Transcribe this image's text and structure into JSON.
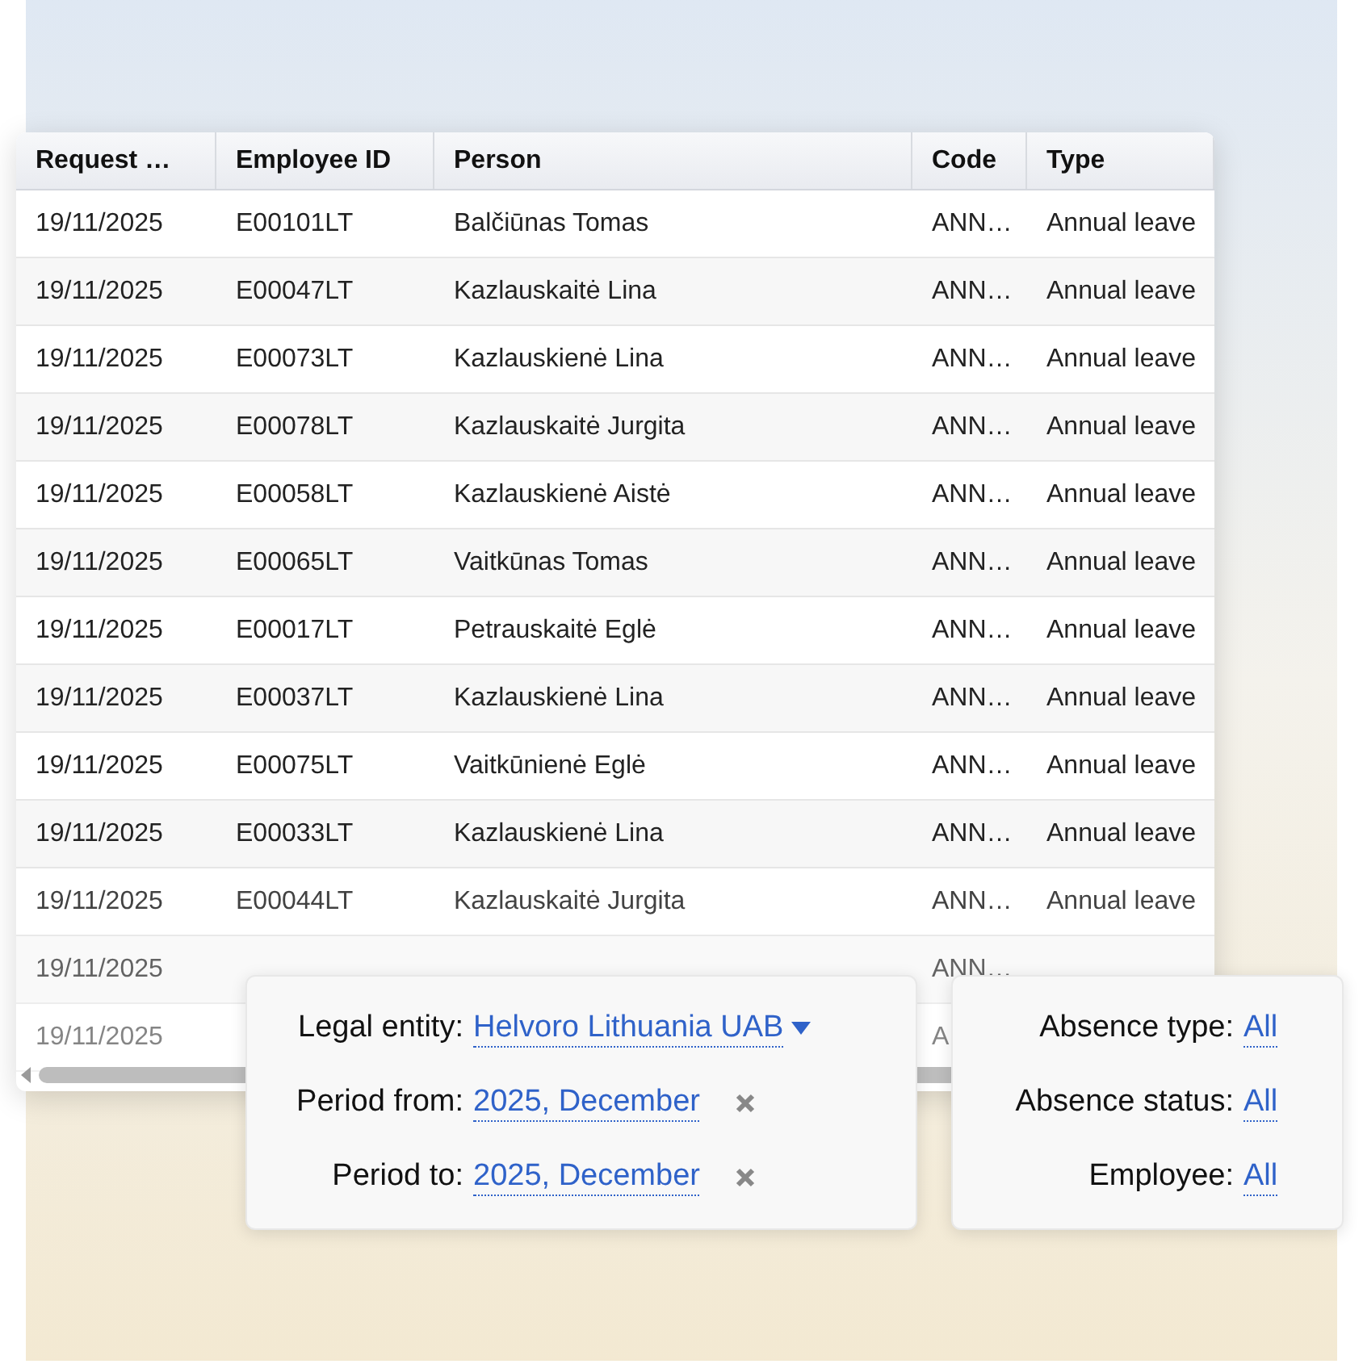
{
  "table": {
    "columns": [
      "Request …",
      "Employee ID",
      "Person",
      "Code",
      "Type"
    ],
    "rows": [
      [
        "19/11/2025",
        "E00101LT",
        "Balčiūnas Tomas",
        "ANN…",
        "Annual leave"
      ],
      [
        "19/11/2025",
        "E00047LT",
        "Kazlauskaitė Lina",
        "ANN…",
        "Annual leave"
      ],
      [
        "19/11/2025",
        "E00073LT",
        "Kazlauskienė Lina",
        "ANN…",
        "Annual leave"
      ],
      [
        "19/11/2025",
        "E00078LT",
        "Kazlauskaitė Jurgita",
        "ANN…",
        "Annual leave"
      ],
      [
        "19/11/2025",
        "E00058LT",
        "Kazlauskienė Aistė",
        "ANN…",
        "Annual leave"
      ],
      [
        "19/11/2025",
        "E00065LT",
        "Vaitkūnas Tomas",
        "ANN…",
        "Annual leave"
      ],
      [
        "19/11/2025",
        "E00017LT",
        "Petrauskaitė Eglė",
        "ANN…",
        "Annual leave"
      ],
      [
        "19/11/2025",
        "E00037LT",
        "Kazlauskienė Lina",
        "ANN…",
        "Annual leave"
      ],
      [
        "19/11/2025",
        "E00075LT",
        "Vaitkūnienė Eglė",
        "ANN…",
        "Annual leave"
      ],
      [
        "19/11/2025",
        "E00033LT",
        "Kazlauskienė Lina",
        "ANN…",
        "Annual leave"
      ],
      [
        "19/11/2025",
        "E00044LT",
        "Kazlauskaitė Jurgita",
        "ANN…",
        "Annual leave"
      ],
      [
        "19/11/2025",
        "",
        "",
        "ANN…",
        ""
      ],
      [
        "19/11/2025",
        "",
        "",
        "A",
        ""
      ]
    ]
  },
  "filters_left": [
    {
      "label": "Legal entity:",
      "value": "Helvoro Lithuania UAB",
      "kind": "dropdown"
    },
    {
      "label": "Period from:",
      "value": "2025, December",
      "kind": "clearable"
    },
    {
      "label": "Period to:",
      "value": "2025, December",
      "kind": "clearable"
    }
  ],
  "filters_right": [
    {
      "label": "Absence type:",
      "value": "All"
    },
    {
      "label": "Absence status:",
      "value": "All"
    },
    {
      "label": "Employee:",
      "value": "All"
    }
  ]
}
